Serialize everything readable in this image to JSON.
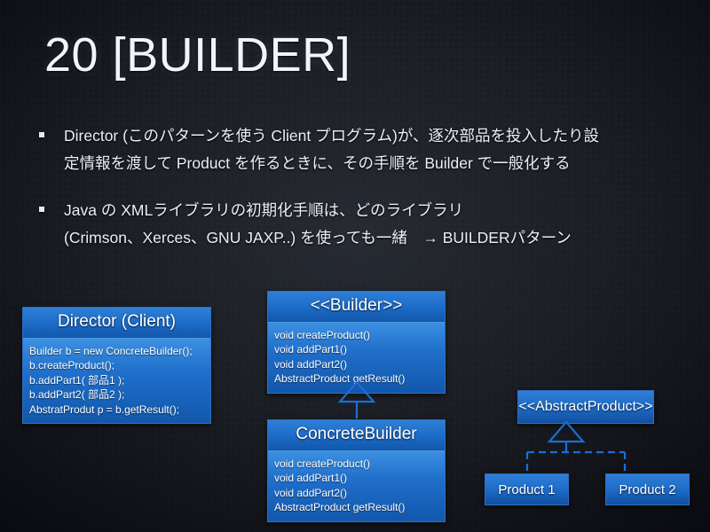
{
  "slide": {
    "title": "20 [BUILDER]",
    "bullets": [
      {
        "marker": "square-bullet",
        "lines": [
          "Director (このパターンを使う Client プログラム)が、逐次部品を投入したり設",
          "定情報を渡して Product を作るときに、その手順を Builder で一般化する"
        ]
      },
      {
        "marker": "square-bullet",
        "lines": [
          "Java の XMLライブラリの初期化手順は、どのライブラリ",
          "(Crimson、Xerces、GNU JAXP..) を使っても一緒　→ BUILDERパターン"
        ]
      }
    ]
  },
  "diagram": {
    "director": {
      "header": "Director (Client)",
      "lines": [
        "Builder b = new ConcreteBuilder();",
        "b.createProduct();",
        "b.addPart1( 部品1 );",
        "b.addPart2( 部品2 );",
        "AbstratProdut p = b.getResult();"
      ]
    },
    "builder": {
      "header": "<<Builder>>",
      "lines": [
        "void createProduct()",
        "void addPart1()",
        "void addPart2()",
        "AbstractProduct getResult()"
      ]
    },
    "concrete_builder": {
      "header": "ConcreteBuilder",
      "lines": [
        "void createProduct()",
        "void addPart1()",
        "void addPart2()",
        "AbstractProduct getResult()"
      ]
    },
    "abstract_product": {
      "header": "<<AbstractProduct>>"
    },
    "product1": {
      "header": "Product 1"
    },
    "product2": {
      "header": "Product 2"
    },
    "connectors": {
      "builder_generalization": "hollow-triangle-solid-line",
      "product_generalization": "hollow-triangle-dashed-line"
    }
  },
  "colors": {
    "box_fill_top": "#3c90e0",
    "box_fill_bottom": "#1257ab",
    "box_border": "#2e6fc4",
    "connector_line": "#1a6fd4",
    "text": "#ffffff",
    "background": "#17181a"
  }
}
